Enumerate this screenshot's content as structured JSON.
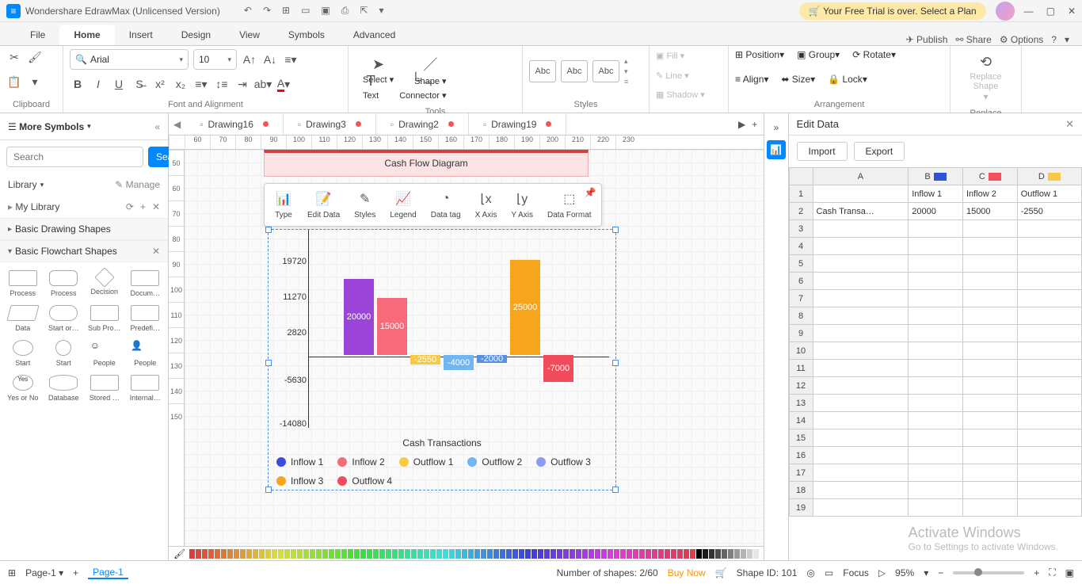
{
  "app": {
    "title": "Wondershare EdrawMax (Unlicensed Version)",
    "trial_banner": "Your Free Trial is over. Select a Plan"
  },
  "menu_tabs": {
    "items": [
      "File",
      "Home",
      "Insert",
      "Design",
      "View",
      "Symbols",
      "Advanced"
    ],
    "active": 1,
    "right": {
      "publish": "Publish",
      "share": "Share",
      "options": "Options"
    }
  },
  "ribbon": {
    "clipboard": "Clipboard",
    "font_name": "Arial",
    "font_size": "10",
    "font_align": "Font and Alignment",
    "select": "Select",
    "shape": "Shape",
    "text": "Text",
    "connector": "Connector",
    "tools": "Tools",
    "abc": "Abc",
    "styles": "Styles",
    "fill": "Fill",
    "line": "Line",
    "shadow": "Shadow",
    "position": "Position",
    "group": "Group",
    "rotate": "Rotate",
    "align": "Align",
    "arr_size": "Size",
    "lock": "Lock",
    "arrangement": "Arrangement",
    "replace_shape": "Replace\nShape",
    "replace": "Replace"
  },
  "symbols": {
    "header": "More Symbols",
    "search_placeholder": "Search",
    "search_btn": "Search",
    "library": "Library",
    "manage": "Manage",
    "my_library": "My Library",
    "basic_drawing": "Basic Drawing Shapes",
    "basic_flowchart": "Basic Flowchart Shapes",
    "shapes": [
      "Process",
      "Process",
      "Decision",
      "Docum…",
      "Data",
      "Start or…",
      "Sub Pro…",
      "Predefi…",
      "Start",
      "Start",
      "People",
      "People",
      "Yes or No",
      "Database",
      "Stored …",
      "Internal…"
    ]
  },
  "doctabs": {
    "items": [
      "Drawing16",
      "Drawing3",
      "Drawing2",
      "Drawing19"
    ]
  },
  "ruler_h": [
    "60",
    "70",
    "80",
    "90",
    "100",
    "110",
    "120",
    "130",
    "140",
    "150",
    "160",
    "170",
    "180",
    "190",
    "200",
    "210",
    "220",
    "230"
  ],
  "ruler_v": [
    "50",
    "60",
    "70",
    "80",
    "90",
    "100",
    "110",
    "120",
    "130",
    "140",
    "150"
  ],
  "chart_header": "Cash Flow Diagram",
  "mini_toolbar": {
    "type": "Type",
    "edit": "Edit Data",
    "styles": "Styles",
    "legend": "Legend",
    "datatag": "Data tag",
    "xaxis": "X Axis",
    "yaxis": "Y Axis",
    "format": "Data Format"
  },
  "chart_data": {
    "type": "bar",
    "title": "Cash Flow Diagram",
    "categories": [
      "Cash Transactions"
    ],
    "series": [
      {
        "name": "Inflow 1",
        "value": 20000,
        "color": "#9b44d8"
      },
      {
        "name": "Inflow 2",
        "value": 15000,
        "color": "#f76a7a"
      },
      {
        "name": "Outflow 1",
        "value": -2550,
        "color": "#f7c944"
      },
      {
        "name": "Outflow 2",
        "value": -4000,
        "color": "#6fb6f2"
      },
      {
        "name": "Outflow 3",
        "value": -2000,
        "color": "#5a90e2"
      },
      {
        "name": "Inflow 3",
        "value": 25000,
        "color": "#f7a51c"
      },
      {
        "name": "Outflow 4",
        "value": -7000,
        "color": "#f04b5a"
      }
    ],
    "yticks": [
      "19720",
      "11270",
      "2820",
      "-5630",
      "-14080"
    ],
    "xlabel": "Cash Transactions",
    "ylim": [
      -14080,
      25000
    ]
  },
  "edit_panel": {
    "title": "Edit Data",
    "import": "Import",
    "export": "Export",
    "cols": [
      "A",
      "B",
      "C",
      "D"
    ],
    "col_colors": {
      "B": "#3050d8",
      "C": "#f05060",
      "D": "#f7c944"
    },
    "row1": [
      "",
      "Inflow 1",
      "Inflow 2",
      "Outflow 1"
    ],
    "row2": [
      "Cash Transa…",
      "20000",
      "15000",
      "-2550"
    ],
    "row_labels": [
      "1",
      "2",
      "3",
      "4",
      "5",
      "6",
      "7",
      "8",
      "9",
      "10",
      "11",
      "12",
      "13",
      "14",
      "15",
      "16",
      "17",
      "18",
      "19"
    ]
  },
  "statusbar": {
    "page_selector": "Page-1",
    "page_tab": "Page-1",
    "shapes_count": "Number of shapes: 2/60",
    "buy_now": "Buy Now",
    "shape_id": "Shape ID: 101",
    "focus": "Focus",
    "zoom": "95%"
  },
  "watermark": {
    "line1": "Activate Windows",
    "line2": "Go to Settings to activate Windows."
  }
}
